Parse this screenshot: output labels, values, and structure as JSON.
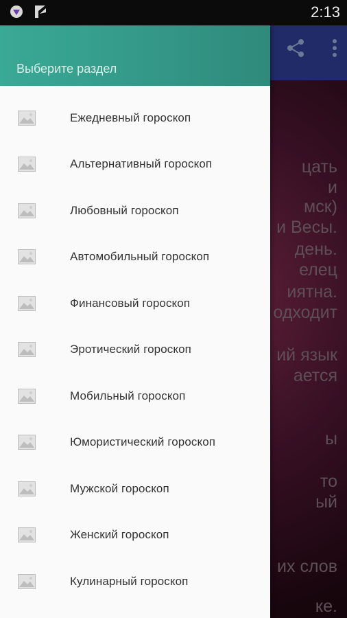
{
  "status_bar": {
    "time": "2:13"
  },
  "app_bar": {
    "share_icon": "share-icon",
    "overflow_icon": "more-vert-icon",
    "color": "#2d3a8a"
  },
  "drawer": {
    "header_title": "Выберите раздел",
    "header_color": "#3aa996",
    "items": [
      {
        "label": "Ежедневный гороскоп",
        "icon": "image-icon"
      },
      {
        "label": "Альтернативный гороскоп",
        "icon": "image-icon"
      },
      {
        "label": "Любовный гороскоп",
        "icon": "image-icon"
      },
      {
        "label": "Автомобильный гороскоп",
        "icon": "image-icon"
      },
      {
        "label": "Финансовый гороскоп",
        "icon": "image-icon"
      },
      {
        "label": "Эротический гороскоп",
        "icon": "image-icon"
      },
      {
        "label": "Мобильный гороскоп",
        "icon": "image-icon"
      },
      {
        "label": "Юмористический гороскоп",
        "icon": "image-icon"
      },
      {
        "label": "Мужской гороскоп",
        "icon": "image-icon"
      },
      {
        "label": "Женский гороскоп",
        "icon": "image-icon"
      },
      {
        "label": "Кулинарный гороскоп",
        "icon": "image-icon"
      }
    ]
  },
  "background_content": {
    "lines": [
      "цать",
      "и",
      "мск)",
      "и Весы.",
      "день.",
      "елец",
      "иятна.",
      "одходит",
      "ий язык",
      "ается",
      "ы",
      "то",
      "ый",
      "их слов",
      "ке."
    ]
  }
}
